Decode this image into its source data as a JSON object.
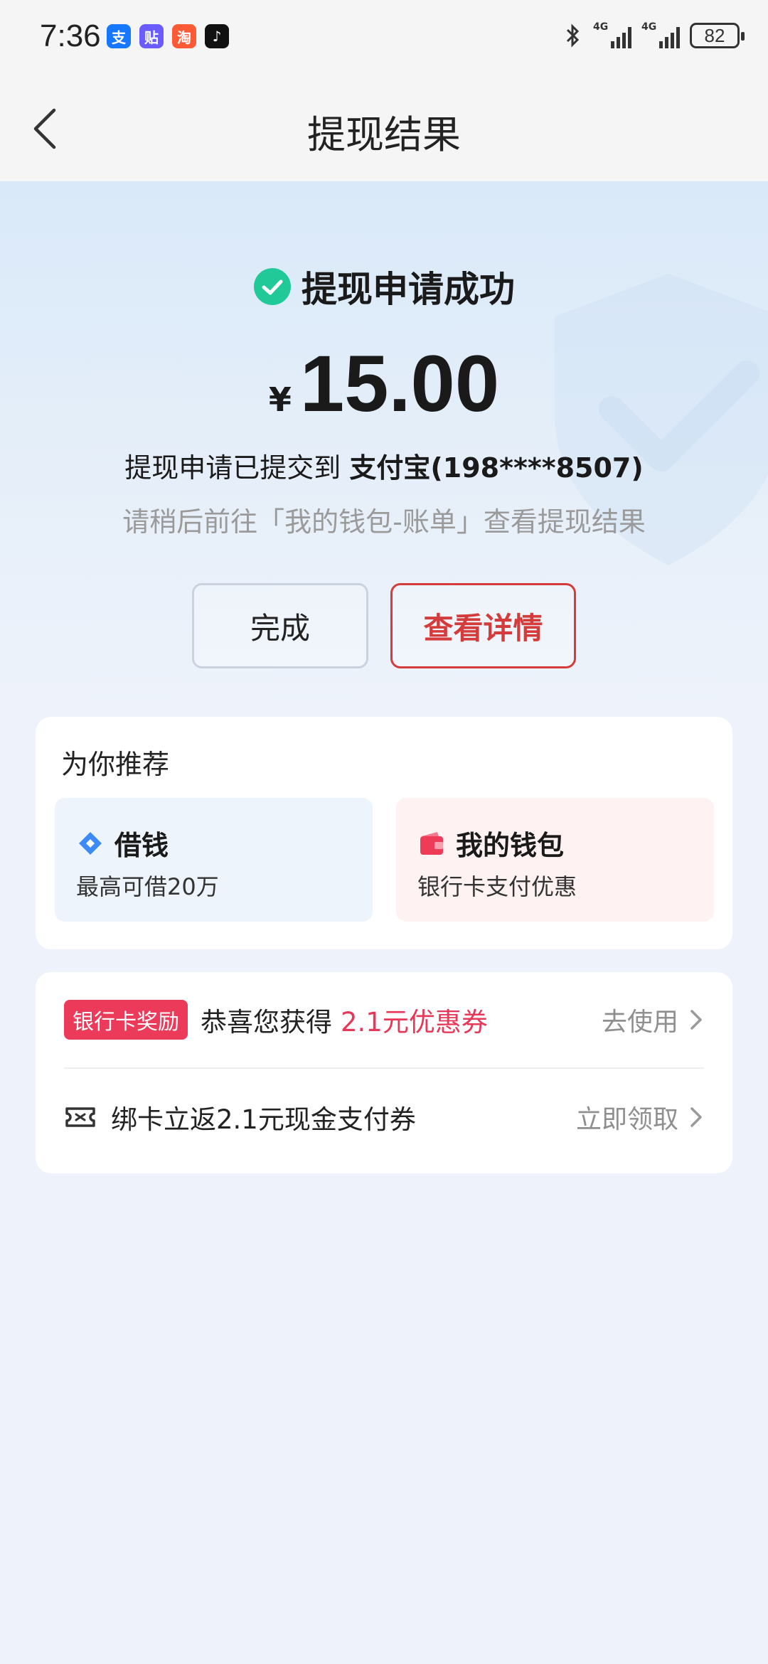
{
  "status_bar": {
    "time": "7:36",
    "apps": [
      {
        "name": "alipay-icon",
        "glyph": "支",
        "color": "#1677ff"
      },
      {
        "name": "tieba-icon",
        "glyph": "贴",
        "color": "#6a5cff"
      },
      {
        "name": "shopping-icon",
        "glyph": "淘",
        "color": "#ff5a36"
      },
      {
        "name": "tiktok-icon",
        "glyph": "♪",
        "color": "#111111"
      }
    ],
    "network_1": "4G",
    "network_2": "4G",
    "battery": "82"
  },
  "navbar": {
    "title": "提现结果"
  },
  "result": {
    "status_text": "提现申请成功",
    "currency": "¥",
    "amount": "15.00",
    "submitted_prefix": "提现申请已提交到 ",
    "account": "支付宝(198****8507)",
    "hint": "请稍后前往「我的钱包-账单」查看提现结果",
    "done_label": "完成",
    "detail_label": "查看详情"
  },
  "recommend": {
    "title": "为你推荐",
    "tiles": [
      {
        "title": "借钱",
        "subtitle": "最高可借20万"
      },
      {
        "title": "我的钱包",
        "subtitle": "银行卡支付优惠"
      }
    ]
  },
  "promos": [
    {
      "badge": "银行卡奖励",
      "text": "恭喜您获得",
      "highlight": "2.1元优惠券",
      "action": "去使用"
    },
    {
      "text": "绑卡立返2.1元现金支付券",
      "action": "立即领取"
    }
  ],
  "colors": {
    "accent_red": "#d43c3c",
    "success_green": "#20c997",
    "promo_pink": "#e8385a",
    "page_bg": "#eef3fb"
  }
}
